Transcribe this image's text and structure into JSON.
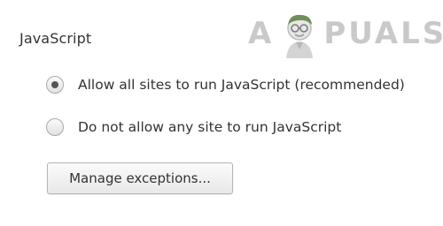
{
  "section": {
    "title": "JavaScript"
  },
  "options": [
    {
      "label": "Allow all sites to run JavaScript (recommended)",
      "checked": true
    },
    {
      "label": "Do not allow any site to run JavaScript",
      "checked": false
    }
  ],
  "manage_button": {
    "label": "Manage exceptions..."
  },
  "watermark": {
    "text_left": "A",
    "text_right": "PUALS",
    "icon": "appuals-mascot-icon"
  }
}
